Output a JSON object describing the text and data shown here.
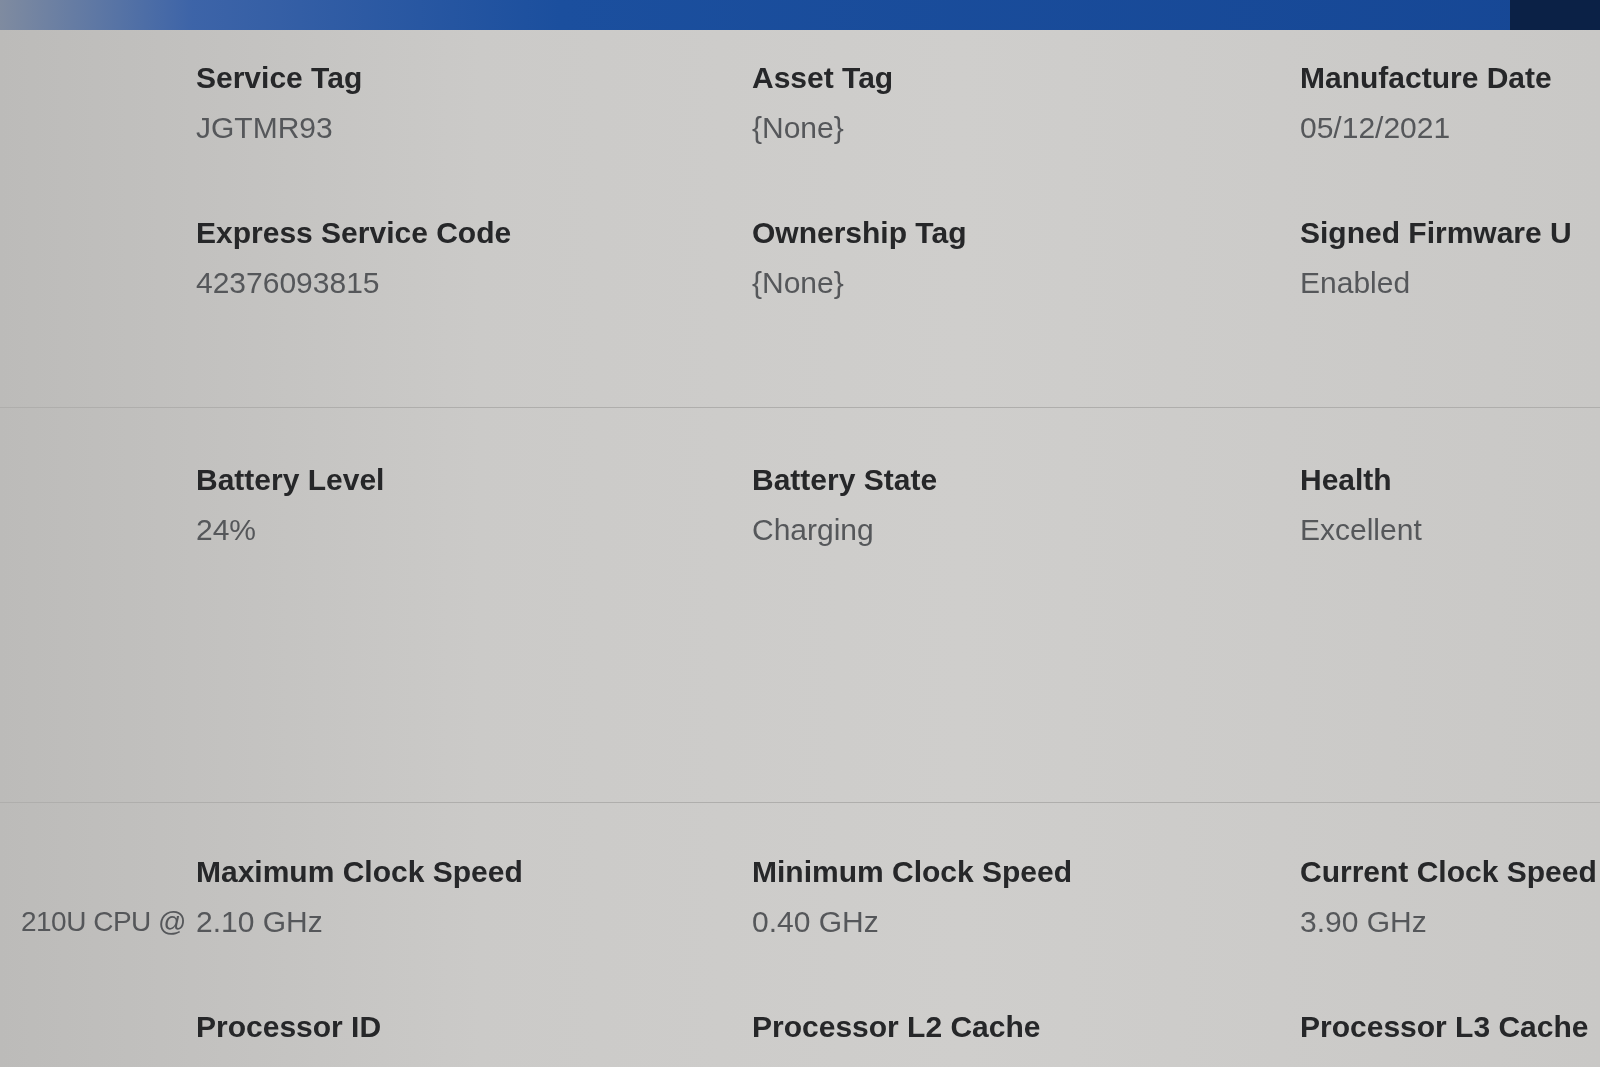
{
  "sections": [
    {
      "rows": [
        {
          "fields": [
            {
              "label": "Service Tag",
              "value": "JGTMR93"
            },
            {
              "label": "Asset Tag",
              "value": "{None}"
            },
            {
              "label": "Manufacture Date",
              "value": "05/12/2021"
            }
          ]
        },
        {
          "fields": [
            {
              "label": "Express Service Code",
              "value": "42376093815"
            },
            {
              "label": "Ownership Tag",
              "value": "{None}"
            },
            {
              "label": "Signed Firmware U",
              "value": "Enabled"
            }
          ]
        }
      ]
    },
    {
      "rows": [
        {
          "fields": [
            {
              "label": "Battery Level",
              "value": "24%"
            },
            {
              "label": "Battery State",
              "value": "Charging"
            },
            {
              "label": "Health",
              "value": "Excellent"
            }
          ]
        }
      ]
    },
    {
      "rows": [
        {
          "lead": "210U CPU @",
          "fields": [
            {
              "label": "Maximum Clock Speed",
              "value": "2.10 GHz"
            },
            {
              "label": "Minimum Clock Speed",
              "value": "0.40 GHz"
            },
            {
              "label": "Current Clock Speed",
              "value": "3.90 GHz"
            }
          ]
        },
        {
          "fields": [
            {
              "label": "Processor ID"
            },
            {
              "label": "Processor L2 Cache"
            },
            {
              "label": "Processor L3 Cache"
            }
          ]
        }
      ]
    }
  ]
}
